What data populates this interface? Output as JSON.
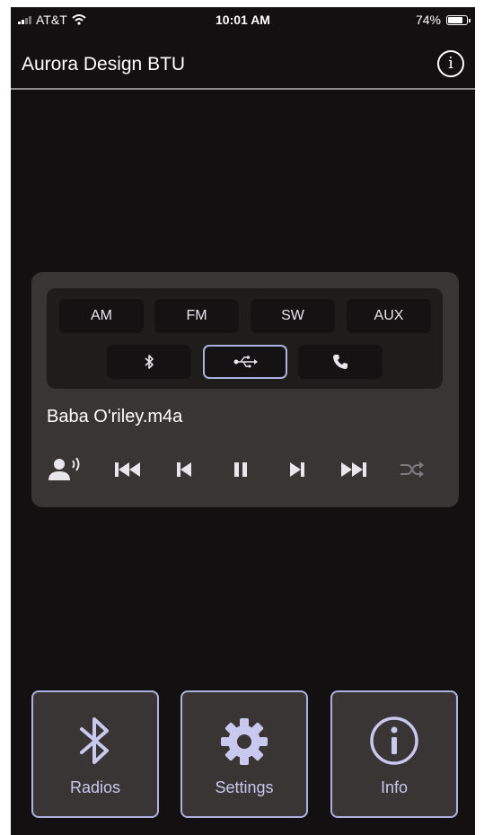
{
  "status_bar": {
    "carrier": "AT&T",
    "time": "10:01 AM",
    "battery": "74%",
    "battery_level": 0.74
  },
  "nav": {
    "title": "Aurora Design BTU",
    "info_icon": "info-icon"
  },
  "colors": {
    "background": "#121010",
    "card": "#3a3535",
    "accent": "#aeb0e0",
    "label": "#c9c9ef"
  },
  "player": {
    "bands": [
      "AM",
      "FM",
      "SW",
      "AUX"
    ],
    "sources": [
      {
        "icon": "bluetooth-icon",
        "active": false
      },
      {
        "icon": "usb-icon",
        "active": true
      },
      {
        "icon": "phone-icon",
        "active": false
      }
    ],
    "track": "Baba O'riley.m4a",
    "controls": [
      "announcer-icon",
      "fast-rewind-icon",
      "previous-icon",
      "pause-icon",
      "next-icon",
      "fast-forward-icon",
      "shuffle-icon"
    ]
  },
  "bottom_bar": {
    "radios_label": "Radios",
    "settings_label": "Settings",
    "info_label": "Info"
  }
}
